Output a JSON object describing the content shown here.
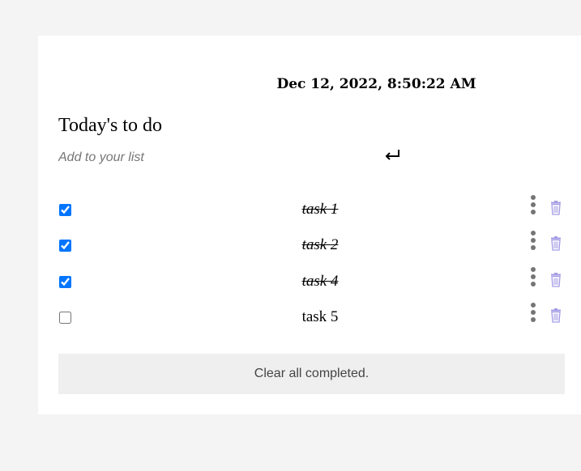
{
  "header": {
    "datetime": "Dec 12, 2022, 8:50:22 AM"
  },
  "todo": {
    "title": "Today's to do",
    "input_placeholder": "Add to your list",
    "input_value": "",
    "enter_icon": "enter-return-arrow-icon",
    "tasks": [
      {
        "label": "task 1",
        "completed": true
      },
      {
        "label": "task 2",
        "completed": true
      },
      {
        "label": "task 4",
        "completed": true
      },
      {
        "label": "task 5",
        "completed": false
      }
    ],
    "clear_label": "Clear all completed."
  },
  "colors": {
    "page_background": "#f4f4f4",
    "card_background": "#ffffff",
    "checkbox_accent": "#0075ff",
    "kebab_dots": "#757575",
    "trash_icon": "#a39ce6",
    "clear_button_background": "#efefef"
  },
  "icons": {
    "menu": "more-vertical-icon",
    "delete": "trash-icon"
  }
}
